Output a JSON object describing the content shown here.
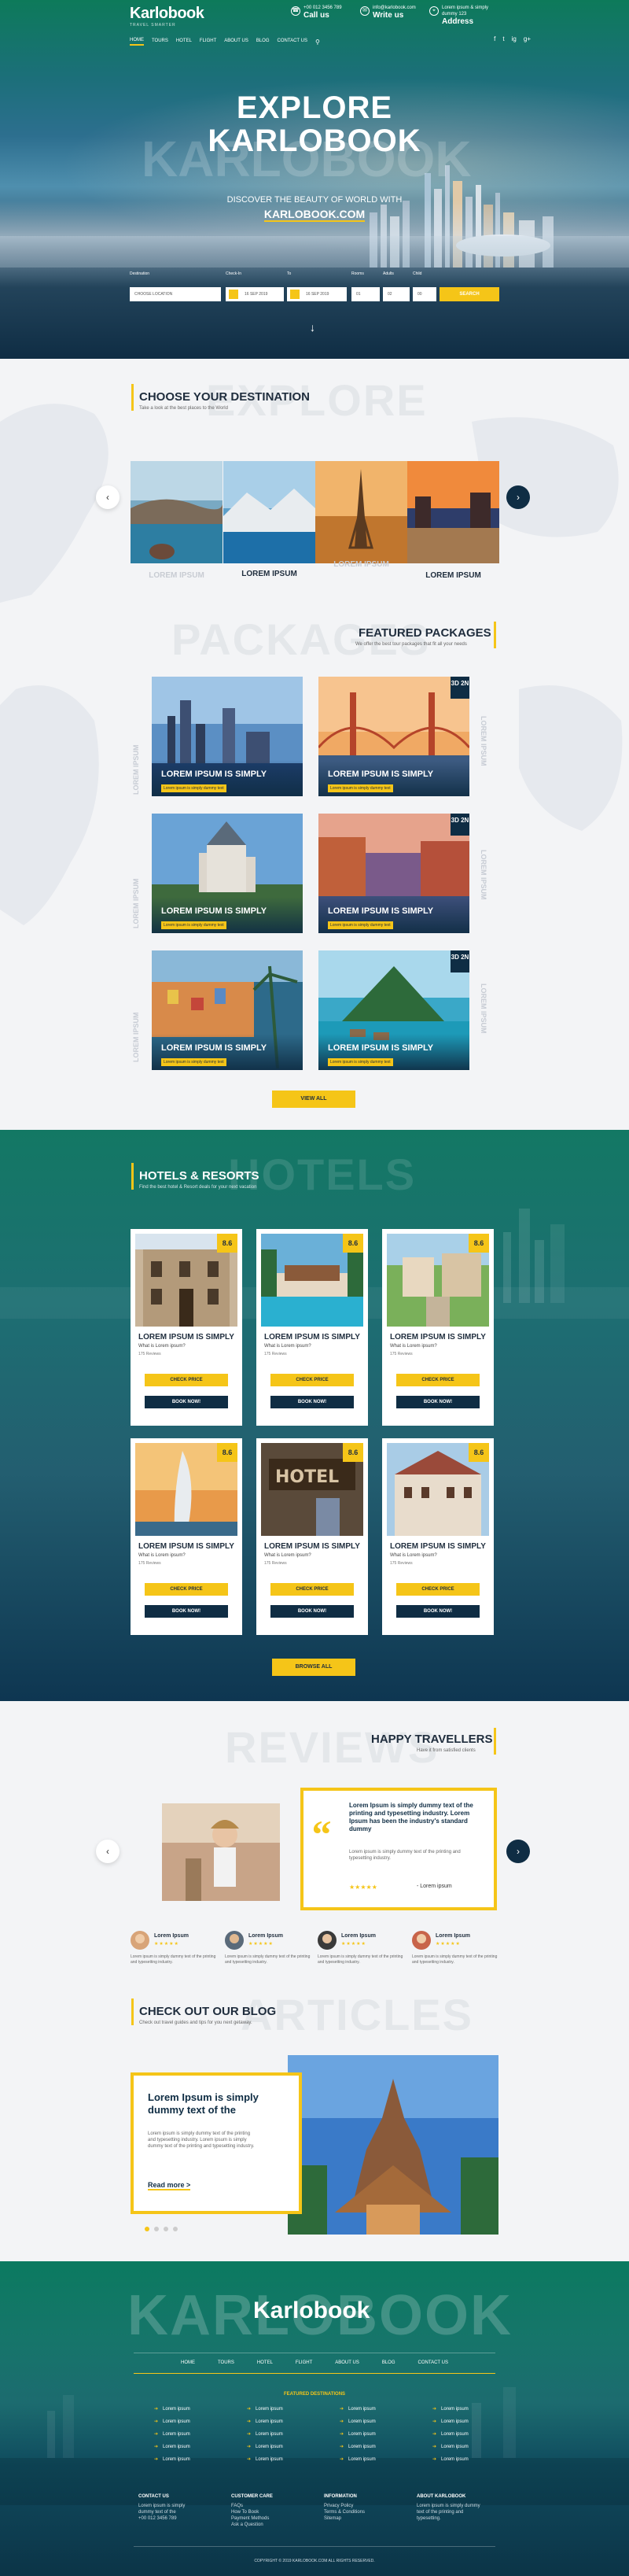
{
  "brand": {
    "logo": "Karlobook",
    "tagline": "TRAVEL SMARTER"
  },
  "contacts": [
    {
      "top": "+00 012 3456 789",
      "label": "Call us",
      "icon": "phone-icon"
    },
    {
      "top": "info@karlobook.com",
      "label": "Write us",
      "icon": "mail-icon"
    },
    {
      "top": "Lorem ipsum & simply dummy 123",
      "label": "Address",
      "icon": "pin-icon"
    }
  ],
  "nav": [
    "HOME",
    "TOURS",
    "HOTEL",
    "FLIGHT",
    "ABOUT US",
    "BLOG",
    "CONTACT US"
  ],
  "social": [
    "f",
    "t",
    "ig",
    "g+"
  ],
  "hero": {
    "title_line1": "EXPLORE",
    "title_line2": "KARLOBOOK",
    "ghost": "KARLOBOOK",
    "tagline": "DISCOVER THE BEAUTY OF WORLD WITH",
    "site": "KARLOBOOK.COM"
  },
  "search": {
    "labels": [
      "Destination",
      "Check-In",
      "To",
      "Rooms",
      "Adults",
      "Child"
    ],
    "destination": "CHOOSE LOCATION",
    "check_in": "16 SEP 2019",
    "check_out": "16 SEP 2019",
    "rooms": "01",
    "adults": "02",
    "child": "00",
    "button": "SEARCH"
  },
  "destinations": {
    "ghost": "EXPLORE",
    "title": "CHOOSE YOUR DESTINATION",
    "subtitle": "Take a look at the best places to the World",
    "items": [
      "LOREM IPSUM",
      "LOREM IPSUM",
      "LOREM IPSUM",
      "LOREM IPSUM"
    ]
  },
  "packages": {
    "ghost": "PACKAGES",
    "title": "FEATURED PACKAGES",
    "subtitle": "We offer the best tour packages that fit all your needs",
    "card_title": "LOREM IPSUM IS SIMPLY",
    "card_sub": "Lorem ipsum is simply dummy text",
    "badge": "3D 2N",
    "side": "LOREM IPSUM",
    "button": "VIEW ALL"
  },
  "hotels": {
    "ghost": "HOTELS",
    "title": "HOTELS & RESORTS",
    "subtitle": "Find the best hotel & Resort deals for your next vacation",
    "score": "8.6",
    "card_title": "LOREM IPSUM IS SIMPLY",
    "question": "What is Lorem ipsum?",
    "reviews": "175 Reviews",
    "check": "CHECK PRICE",
    "book": "BOOK NOW!",
    "button": "BROWSE ALL"
  },
  "reviews": {
    "ghost": "REVIEWS",
    "title": "HAPPY TRAVELLERS",
    "subtitle": "Have it from satisfied clients",
    "quote": "Lorem Ipsum is simply dummy text of the printing and typesetting industry. Lorem Ipsum has been the industry's standard dummy",
    "text": "Lorem ipsum is simply dummy text of the printing and typesetting industry.",
    "stars": "★★★★★",
    "author": "- Lorem ipsum",
    "mini_name": "Lorem Ipsum",
    "mini_text": "Lorem ipsum is simply dummy text of the printing and typesetting industry."
  },
  "blog": {
    "ghost": "ARTICLES",
    "title": "CHECK OUT OUR BLOG",
    "subtitle": "Check out travel guides and tips for you next getaway.",
    "card_title": "Lorem Ipsum is simply dummy text of the",
    "card_text": "Lorem ipsum is simply dummy text of the printing and typesetting industry. Lorem ipsum is simply dummy text of the printing and typesetting industry.",
    "read_more": "Read more >"
  },
  "footer": {
    "ghost": "KARLOBOOK",
    "logo": "Karlobook",
    "nav": [
      "HOME",
      "TOURS",
      "HOTEL",
      "FLIGHT",
      "ABOUT US",
      "BLOG",
      "CONTACT US"
    ],
    "dest_title": "FEATURED DESTINATIONS",
    "dest_item": "Lorem ipsum",
    "contact": {
      "h": "CONTACT US",
      "l1": "Lorem ipsum is simply",
      "l2": "dummy text of the",
      "l3": "+00 012 3456 789"
    },
    "customer": {
      "h": "CUSTOMER CARE",
      "l1": "FAQs",
      "l2": "How To Book",
      "l3": "Payment Methods",
      "l4": "Ask a Question"
    },
    "info": {
      "h": "INFORMATION",
      "l1": "Privacy Policy",
      "l2": "Terms & Conditions",
      "l3": "Sitemap"
    },
    "about": {
      "h": "ABOUT KARLOBOOK",
      "l1": "Lorem ipsum is simply dummy",
      "l2": "text of the printing and",
      "l3": "typesetting."
    },
    "copyright": "COPYRIGHT © 2019 KARLOBOOK.COM ALL RIGHTS RESERVED."
  },
  "colors": {
    "accent": "#f5c518",
    "navy": "#0f2d44",
    "teal": "#0b7a60"
  }
}
